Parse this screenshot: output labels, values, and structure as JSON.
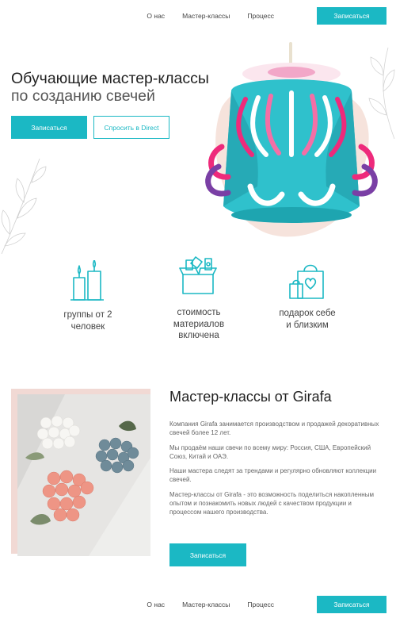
{
  "nav": {
    "links": [
      "О нас",
      "Мастер-классы",
      "Процесс"
    ],
    "cta": "Записаться"
  },
  "hero": {
    "title_line1": "Обучающие мастер-классы",
    "title_line2": "по созданию свечей",
    "primary_button": "Записаться",
    "secondary_button": "Спросить в Direct"
  },
  "features": [
    {
      "icon": "candles-icon",
      "text_line1": "группы от 2",
      "text_line2": "человек"
    },
    {
      "icon": "materials-box-icon",
      "text_line1": "стоимость",
      "text_line2": "материалов",
      "text_line3": "включена"
    },
    {
      "icon": "gift-bag-icon",
      "text_line1": "подарок себе",
      "text_line2": "и близким"
    }
  ],
  "about": {
    "title": "Мастер-классы от Girafa",
    "paragraphs": [
      "Компания Girafa занимается производством и продажей декоративных свечей более 12 лет.",
      "Мы продаём наши свечи по всему миру: Россия, США, Европейский Союз, Китай и ОАЭ.",
      "Наши мастера следят за трендами и регулярно обновляют коллекции свечей.",
      "Мастер-классы от Girafa - это возможность поделиться накопленным опытом и познакомить новых людей с качеством продукции и процессом нашего производства."
    ],
    "button": "Записаться"
  },
  "colors": {
    "accent": "#1bb8c4",
    "blob": "#f6e3dc",
    "photo_frame": "#f1d9d4"
  }
}
